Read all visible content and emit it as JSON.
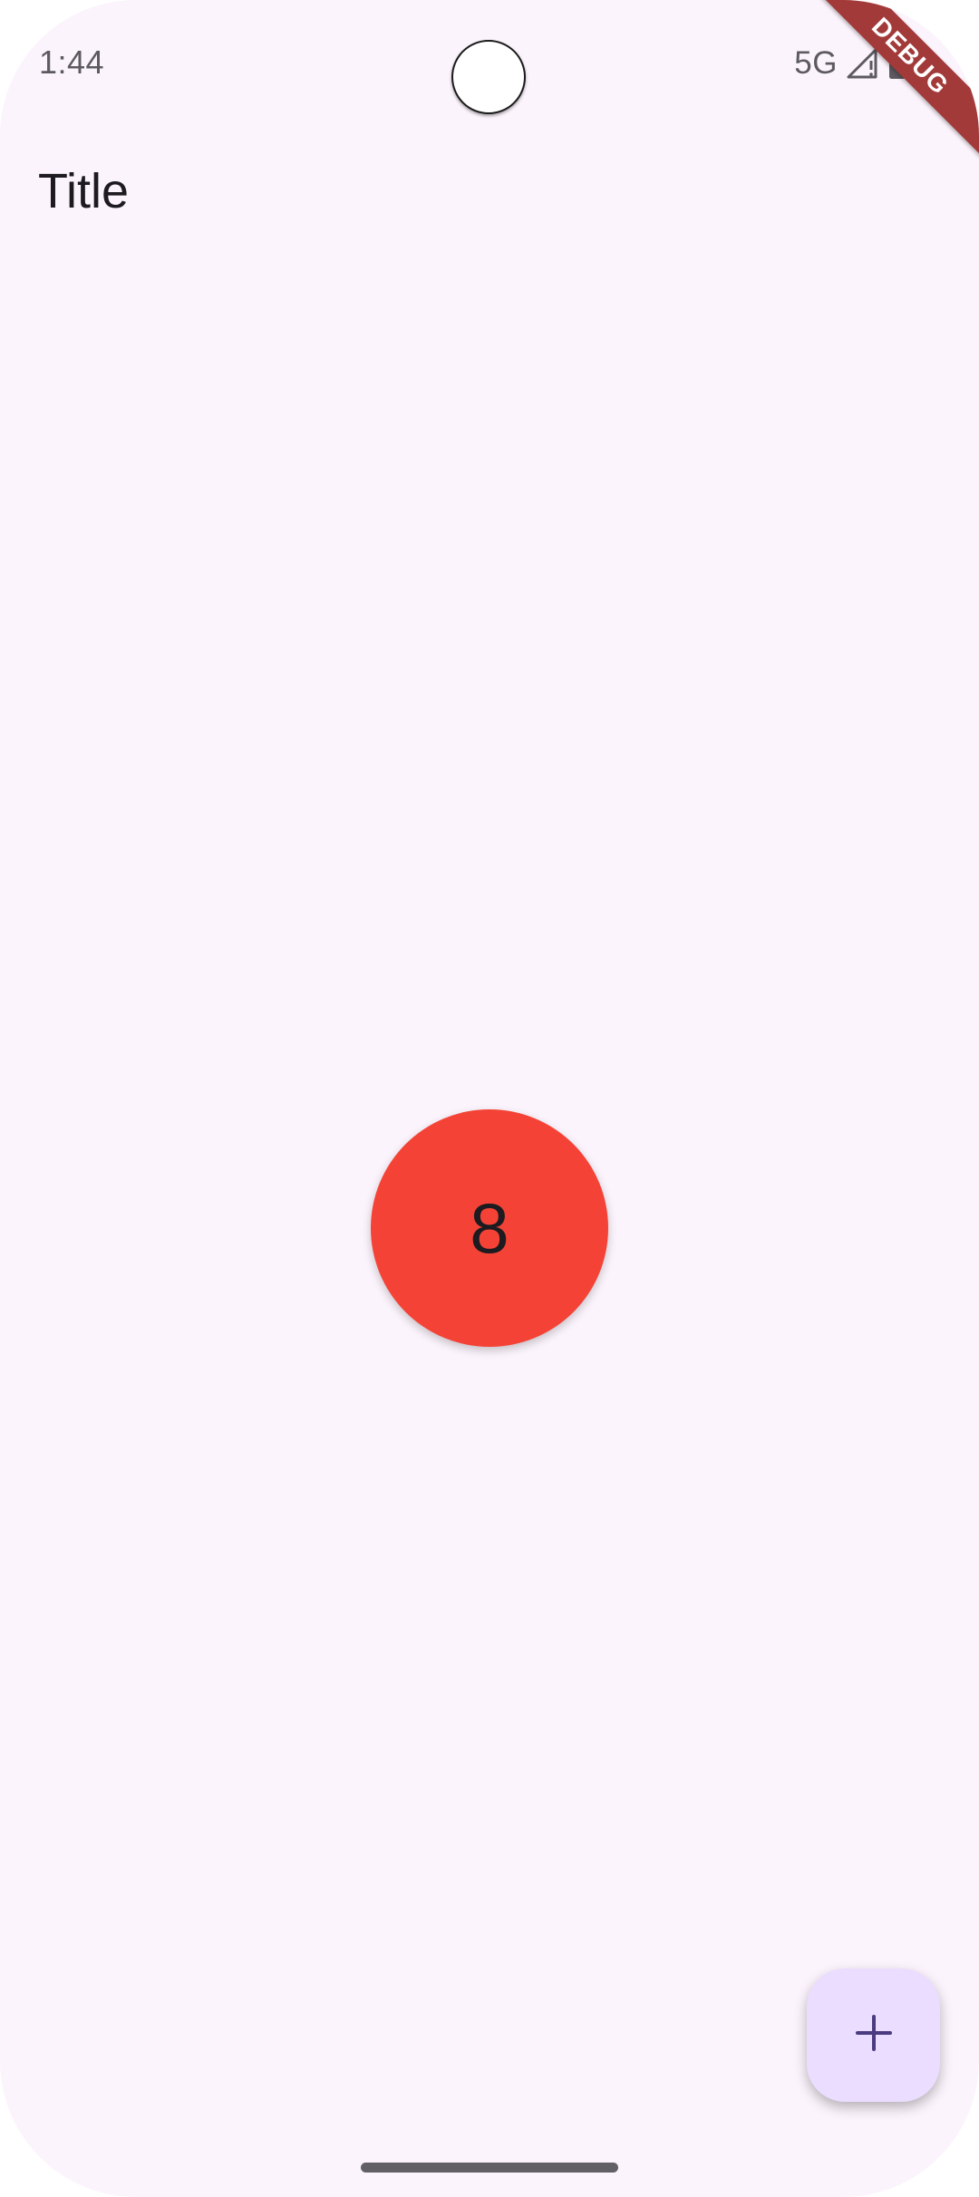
{
  "status_bar": {
    "time": "1:44",
    "network": "5G",
    "signal_icon": "cellular-signal-no-data-icon",
    "battery_icon": "battery-full-icon"
  },
  "debug_banner": {
    "label": "DEBUG",
    "color": "#a33a3a"
  },
  "app_bar": {
    "title": "Title"
  },
  "counter": {
    "value": "8",
    "color": "#f44336"
  },
  "fab": {
    "icon": "plus-icon",
    "color": "#eaddff",
    "icon_color": "#4a3a80"
  },
  "colors": {
    "background": "#fcf4fc",
    "text": "#1d1b20"
  }
}
